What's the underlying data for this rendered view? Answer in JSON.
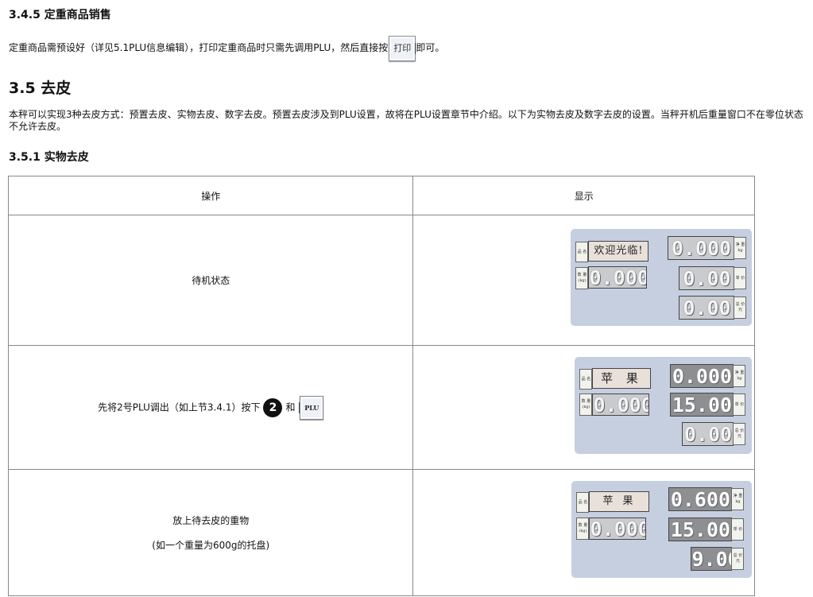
{
  "section_345": {
    "heading": "3.4.5 定重商品销售",
    "text_before": "定重商品需预设好（详见5.1PLU信息编辑），打印定重商品时只需先调用PLU，然后直接按",
    "print_key": "打印",
    "text_after": "即可。"
  },
  "section_35": {
    "heading": "3.5 去皮",
    "paragraph": "本秤可以实现3种去皮方式：预置去皮、实物去皮、数字去皮。预置去皮涉及到PLU设置，故将在PLU设置章节中介绍。以下为实物去皮及数字去皮的设置。当秤开机后重量窗口不在零位状态不允许去皮。"
  },
  "section_351": {
    "heading": "3.5.1 实物去皮"
  },
  "table": {
    "headers": [
      "操作",
      "显示"
    ],
    "rows": [
      {
        "operation": "待机状态",
        "display": {
          "name": "欢迎光临!",
          "weight": "0.000",
          "unit_price": "0.00",
          "total": "0.00",
          "qty": "0.000"
        }
      },
      {
        "operation_prefix": "先将2号PLU调出（如上节3.4.1）按下",
        "key_number": "2",
        "operation_and": "和",
        "plu_key": "PLU",
        "display": {
          "name": "苹 果",
          "weight": "0.000",
          "unit_price": "15.00",
          "total": "0.00",
          "qty": "0.000"
        }
      },
      {
        "operation_line1": "放上待去皮的重物",
        "operation_line2": "(如一个重量为600g的托盘)",
        "display": {
          "name": "苹 果",
          "weight": "0.600",
          "unit_price": "15.00",
          "total": "9.00",
          "qty": "0.000"
        }
      }
    ],
    "panel_tags": {
      "name": "品 名",
      "qty": "数 量 (kg)",
      "weight": "净 重 kg",
      "unit_price": "单 价",
      "total": "总 价 元"
    }
  },
  "colors": {
    "panel_bg": "#c6cfe0",
    "lcd_bg": "#8d8f92",
    "name_bg": "#e9e0da"
  }
}
